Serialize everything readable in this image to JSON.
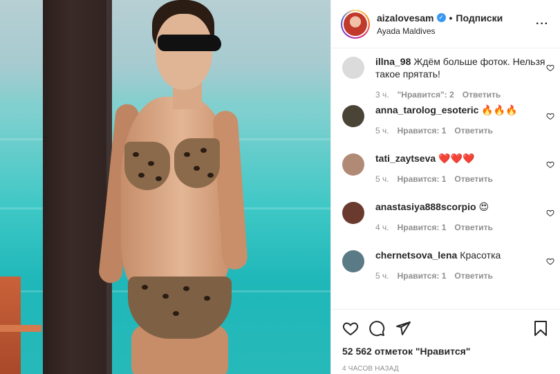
{
  "header": {
    "username": "aizalovesam",
    "verified_mark": "✓",
    "separator": "•",
    "follow_label": "Подписки",
    "location": "Ayada Maldives",
    "more_icon": "···"
  },
  "comments": [
    {
      "user": "illna_98",
      "text": "Ждём больше фоток. Нельзя такое прятать!",
      "time": "3 ч.",
      "likes": "\"Нравится\": 2",
      "reply": "Ответить",
      "avatar_color": "#dbdbdb"
    },
    {
      "user": "anna_tarolog_esoteric",
      "text": "🔥🔥🔥",
      "time": "5 ч.",
      "likes": "Нравится: 1",
      "reply": "Ответить",
      "avatar_color": "#4a4436"
    },
    {
      "user": "tati_zaytseva",
      "text": "❤️❤️❤️",
      "time": "5 ч.",
      "likes": "Нравится: 1",
      "reply": "Ответить",
      "avatar_color": "#b08a74"
    },
    {
      "user": "anastasiya888scorpio",
      "text": "😍",
      "time": "4 ч.",
      "likes": "Нравится: 1",
      "reply": "Ответить",
      "avatar_color": "#6b3a2e"
    },
    {
      "user": "chernetsova_lena",
      "text": "Красотка",
      "time": "5 ч.",
      "likes": "Нравится: 1",
      "reply": "Ответить",
      "avatar_color": "#5a7a86"
    }
  ],
  "actions": {
    "like_icon": "heart-outline",
    "comment_icon": "speech-bubble",
    "share_icon": "paper-plane",
    "save_icon": "bookmark",
    "likes_count": "52 562 отметок \"Нравится\"",
    "timestamp": "4 ЧАСОВ НАЗАД"
  }
}
